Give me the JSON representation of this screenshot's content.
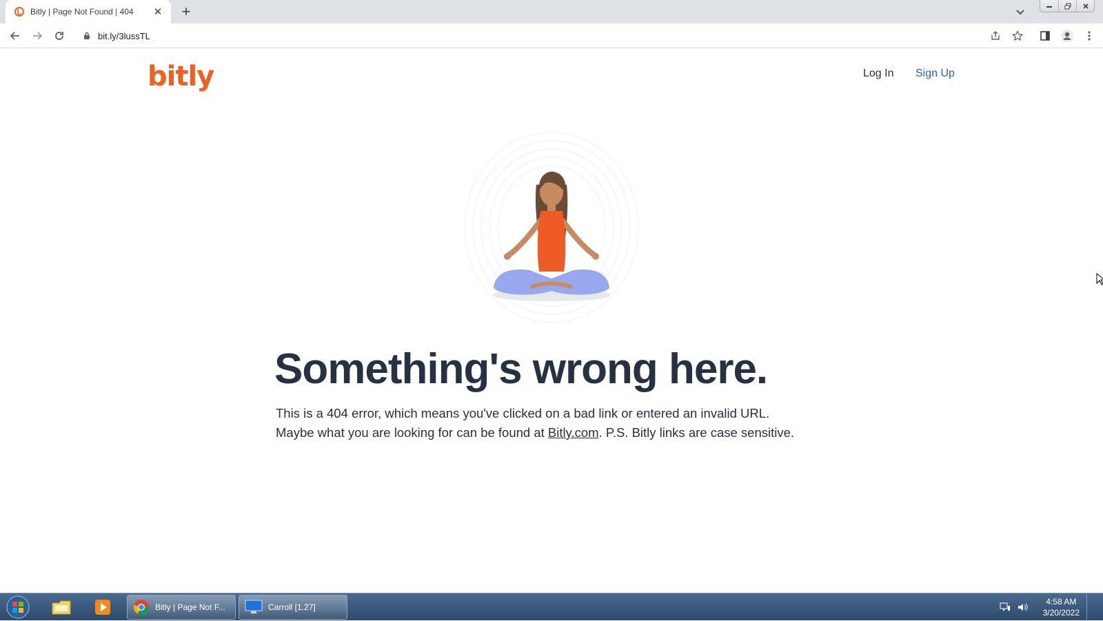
{
  "browser": {
    "tab": {
      "title": "Bitly | Page Not Found | 404",
      "favicon": "bitly-favicon-icon",
      "close": "✕"
    },
    "new_tab_label": "+",
    "url": "bit.ly/3lussTL"
  },
  "page": {
    "logo": "bitly",
    "nav": {
      "login": "Log In",
      "signup": "Sign Up"
    },
    "headline": "Something's wrong here.",
    "body_line1": "This is a 404 error, which means you've clicked on a bad link or entered an invalid URL.",
    "body_line2_prefix": "Maybe what you are looking for can be found at ",
    "body_link": "Bitly.com",
    "body_line2_suffix": ". P.S. Bitly links are case sensitive.",
    "illustration": "meditating-woman-illustration"
  },
  "colors": {
    "brand": "#ee6123",
    "text": "#273144",
    "link": "#2a5bd7",
    "taskbar": "#3a5a7e"
  },
  "taskbar": {
    "tasks": [
      {
        "label": "Bitly | Page Not F...",
        "icon": "chrome-icon"
      },
      {
        "label": "Carroll [1.27]",
        "icon": "monitor-icon"
      }
    ],
    "clock": {
      "time": "4:58 AM",
      "date": "3/20/2022"
    }
  }
}
